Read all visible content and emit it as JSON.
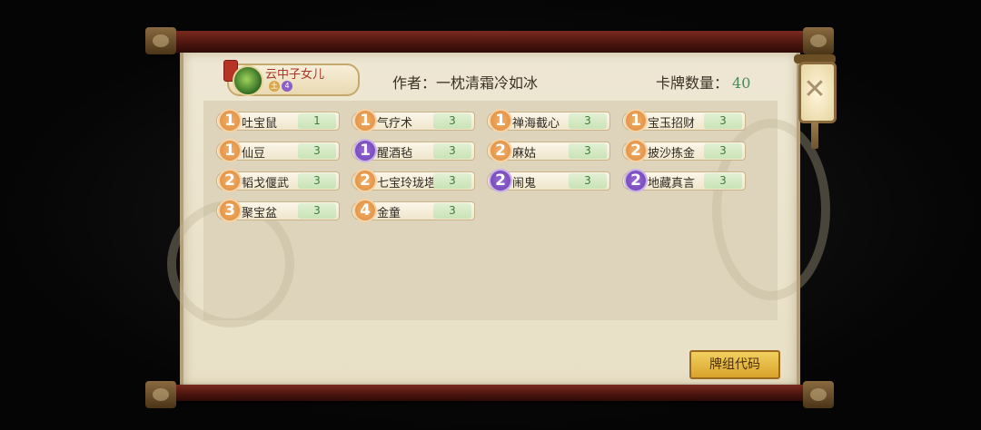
{
  "hero": {
    "name": "云中子女儿",
    "marks": [
      "土",
      "4"
    ]
  },
  "author": {
    "label": "作者：",
    "name": "一枕清霜冷如冰"
  },
  "card_count": {
    "label": "卡牌数量：",
    "value": "40"
  },
  "colors": {
    "cost_orange": "#e0913f",
    "cost_purple": "#7345b7",
    "qty_green": "#3f7a3c"
  },
  "cards": [
    {
      "cost": "1",
      "name": "吐宝鼠",
      "qty": "1",
      "color": "orange"
    },
    {
      "cost": "1",
      "name": "气疗术",
      "qty": "3",
      "color": "orange"
    },
    {
      "cost": "1",
      "name": "禅海截心",
      "qty": "3",
      "color": "orange"
    },
    {
      "cost": "1",
      "name": "宝玉招财",
      "qty": "3",
      "color": "orange"
    },
    {
      "cost": "1",
      "name": "仙豆",
      "qty": "3",
      "color": "orange"
    },
    {
      "cost": "1",
      "name": "醒酒毡",
      "qty": "3",
      "color": "purple"
    },
    {
      "cost": "2",
      "name": "麻姑",
      "qty": "3",
      "color": "orange"
    },
    {
      "cost": "2",
      "name": "披沙拣金",
      "qty": "3",
      "color": "orange"
    },
    {
      "cost": "2",
      "name": "韬戈偃武",
      "qty": "3",
      "color": "orange"
    },
    {
      "cost": "2",
      "name": "七宝玲珑塔",
      "qty": "3",
      "color": "orange"
    },
    {
      "cost": "2",
      "name": "闹鬼",
      "qty": "3",
      "color": "purple"
    },
    {
      "cost": "2",
      "name": "地藏真言",
      "qty": "3",
      "color": "purple"
    },
    {
      "cost": "3",
      "name": "聚宝盆",
      "qty": "3",
      "color": "orange"
    },
    {
      "cost": "4",
      "name": "金童",
      "qty": "3",
      "color": "orange"
    }
  ],
  "deck_code_button": "牌组代码",
  "close_icon": "close-icon"
}
